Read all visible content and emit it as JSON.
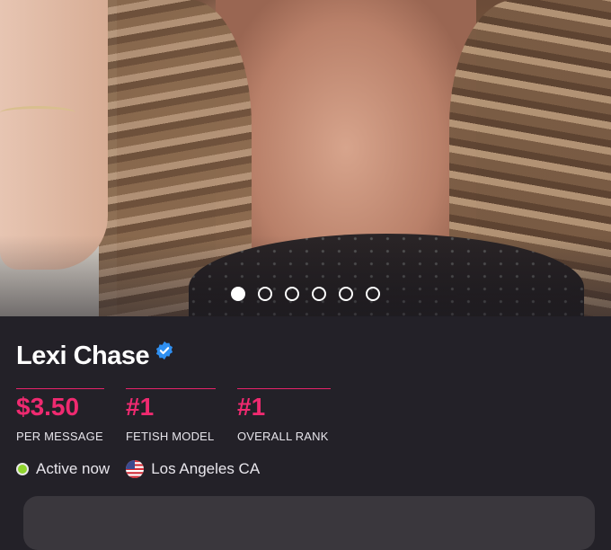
{
  "profile": {
    "name": "Lexi Chase",
    "verified": true,
    "photo_count": 6,
    "active_photo": 1,
    "stats": [
      {
        "value": "$3.50",
        "label": "PER MESSAGE"
      },
      {
        "value": "#1",
        "label": "FETISH MODEL"
      },
      {
        "value": "#1",
        "label": "OVERALL RANK"
      }
    ],
    "status": "Active now",
    "location": "Los Angeles CA"
  },
  "colors": {
    "background": "#232128",
    "accent": "#ef2a70",
    "online": "#8fd42e",
    "verified": "#2f8ff0"
  },
  "icons": [
    "verified-badge-icon",
    "online-status-icon",
    "us-flag-icon"
  ]
}
